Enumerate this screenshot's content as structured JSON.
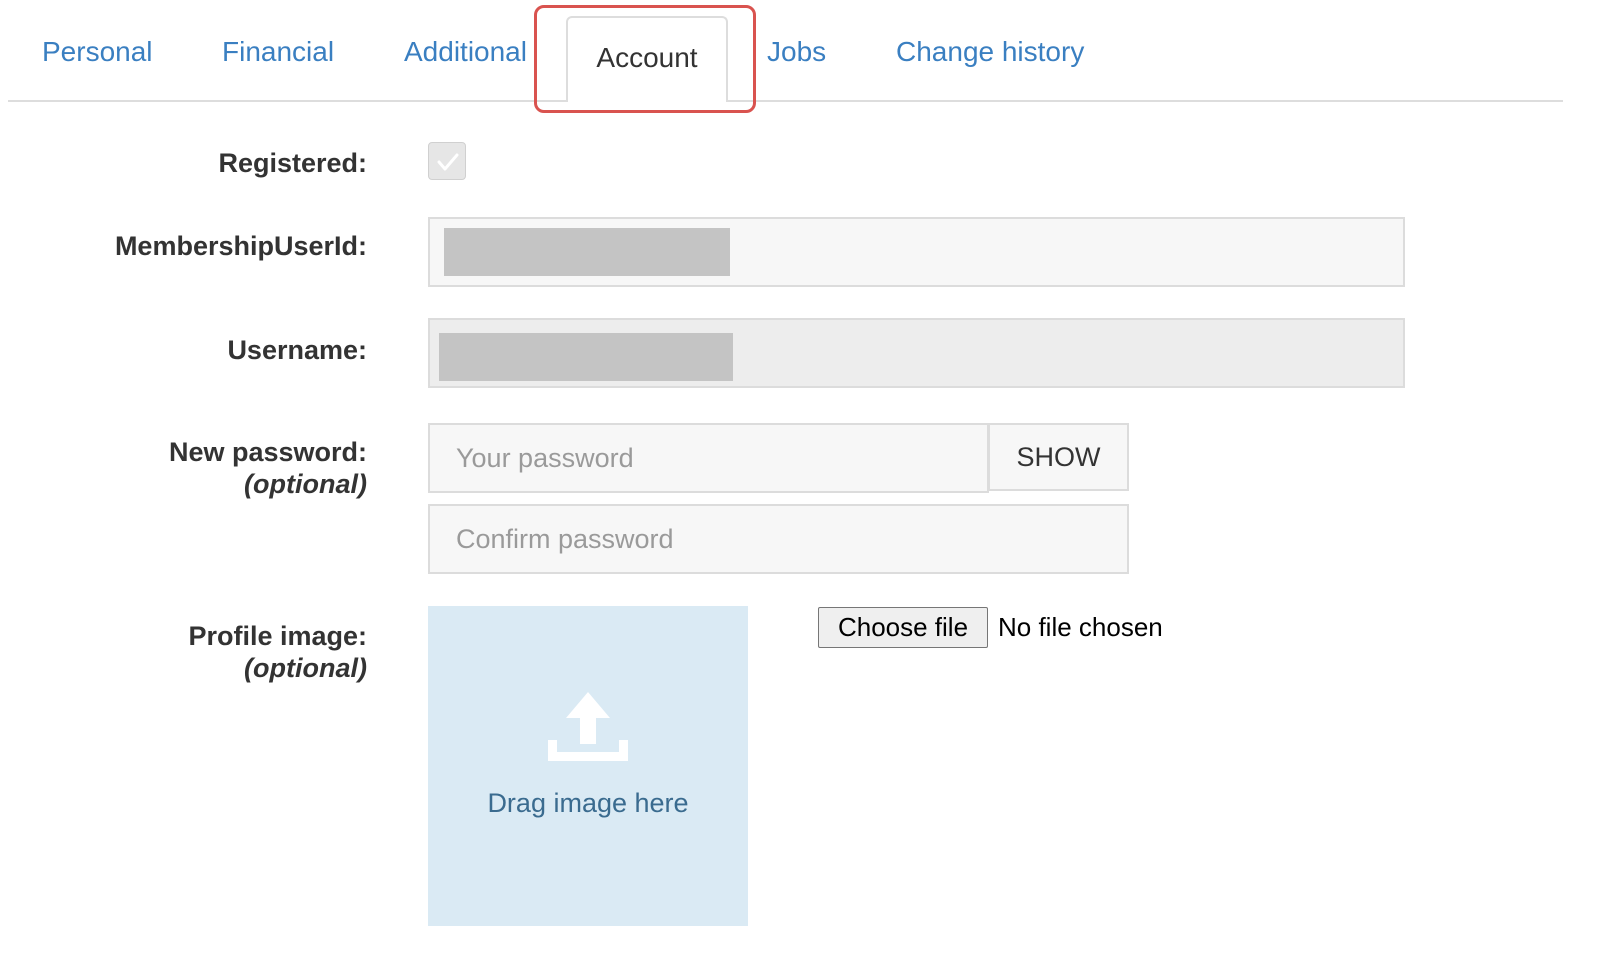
{
  "tabs": [
    {
      "label": "Personal"
    },
    {
      "label": "Financial"
    },
    {
      "label": "Additional"
    },
    {
      "label": "Account"
    },
    {
      "label": "Jobs"
    },
    {
      "label": "Change history"
    }
  ],
  "active_tab": "Account",
  "highlight_color": "#d9534f",
  "form": {
    "registered_label": "Registered:",
    "registered_checked": true,
    "membership_label": "MembershipUserId:",
    "username_label": "Username:",
    "new_password_label": "New password:",
    "new_password_optional": "(optional)",
    "password_placeholder": "Your password",
    "confirm_placeholder": "Confirm password",
    "show_label": "SHOW",
    "profile_image_label": "Profile image:",
    "profile_image_optional": "(optional)",
    "drag_text": "Drag image here",
    "choose_file_label": "Choose file",
    "file_status": "No file chosen"
  },
  "icons": {
    "check": "check-icon",
    "upload": "upload-icon"
  }
}
